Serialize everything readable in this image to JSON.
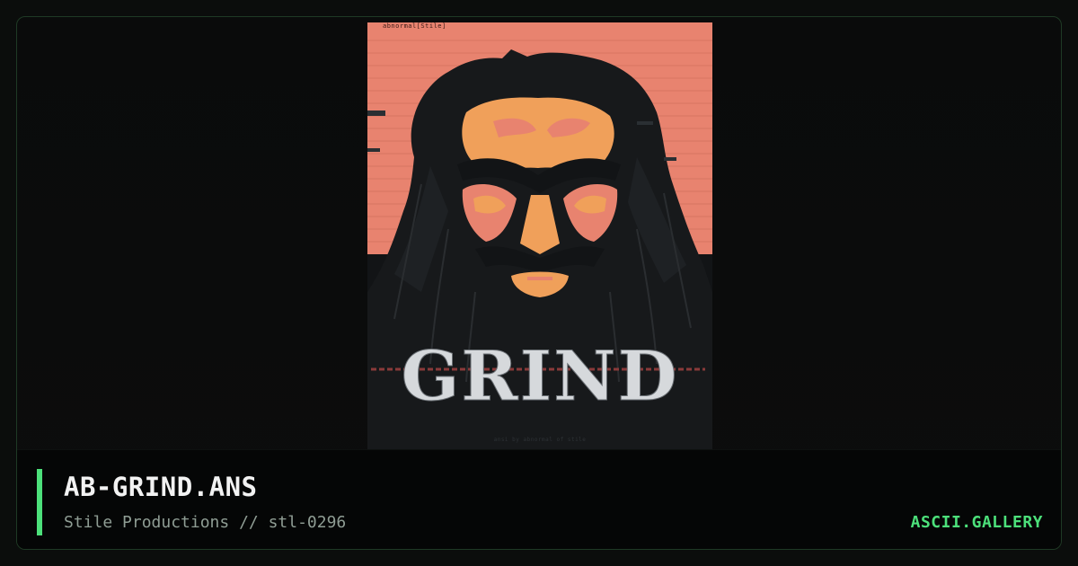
{
  "artwork": {
    "header_text": "abnormal[Stile]",
    "logo_text": "GRIND",
    "credit_text": "ansi by abnormal of stile"
  },
  "info": {
    "title": "AB-GRIND.ANS",
    "subtitle": "Stile Productions // stl-0296",
    "brand": "ASCII.GALLERY"
  },
  "colors": {
    "accent": "#4ce07a",
    "art_salmon": "#e8836f",
    "art_orange": "#f0a05a",
    "background": "#0b0d0c"
  }
}
